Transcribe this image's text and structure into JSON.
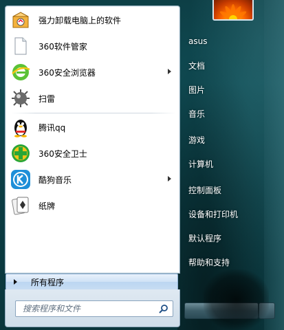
{
  "programs": [
    {
      "label": "强力卸载电脑上的软件",
      "icon": "uninstaller-box-icon",
      "submenu": false
    },
    {
      "label": "360软件管家",
      "icon": "blank-document-icon",
      "submenu": false
    },
    {
      "label": "360安全浏览器",
      "icon": "360-browser-icon",
      "submenu": true
    },
    {
      "label": "扫雷",
      "icon": "minesweeper-mine-icon",
      "submenu": false
    },
    {
      "label": "腾讯qq",
      "icon": "qq-penguin-icon",
      "submenu": false
    },
    {
      "label": "360安全卫士",
      "icon": "360-security-plus-icon",
      "submenu": false
    },
    {
      "label": "酷狗音乐",
      "icon": "kugou-k-icon",
      "submenu": true
    },
    {
      "label": "纸牌",
      "icon": "solitaire-cards-icon",
      "submenu": false
    }
  ],
  "all_programs_label": "所有程序",
  "search": {
    "placeholder": "搜索程序和文件"
  },
  "right_column": [
    "asus",
    "文档",
    "图片",
    "音乐",
    "游戏",
    "计算机",
    "控制面板",
    "设备和打印机",
    "默认程序",
    "帮助和支持"
  ],
  "colors": {
    "accent": "#1e8fd8",
    "panel_bg": "#ffffff",
    "side_bg": "#0f4a52"
  }
}
